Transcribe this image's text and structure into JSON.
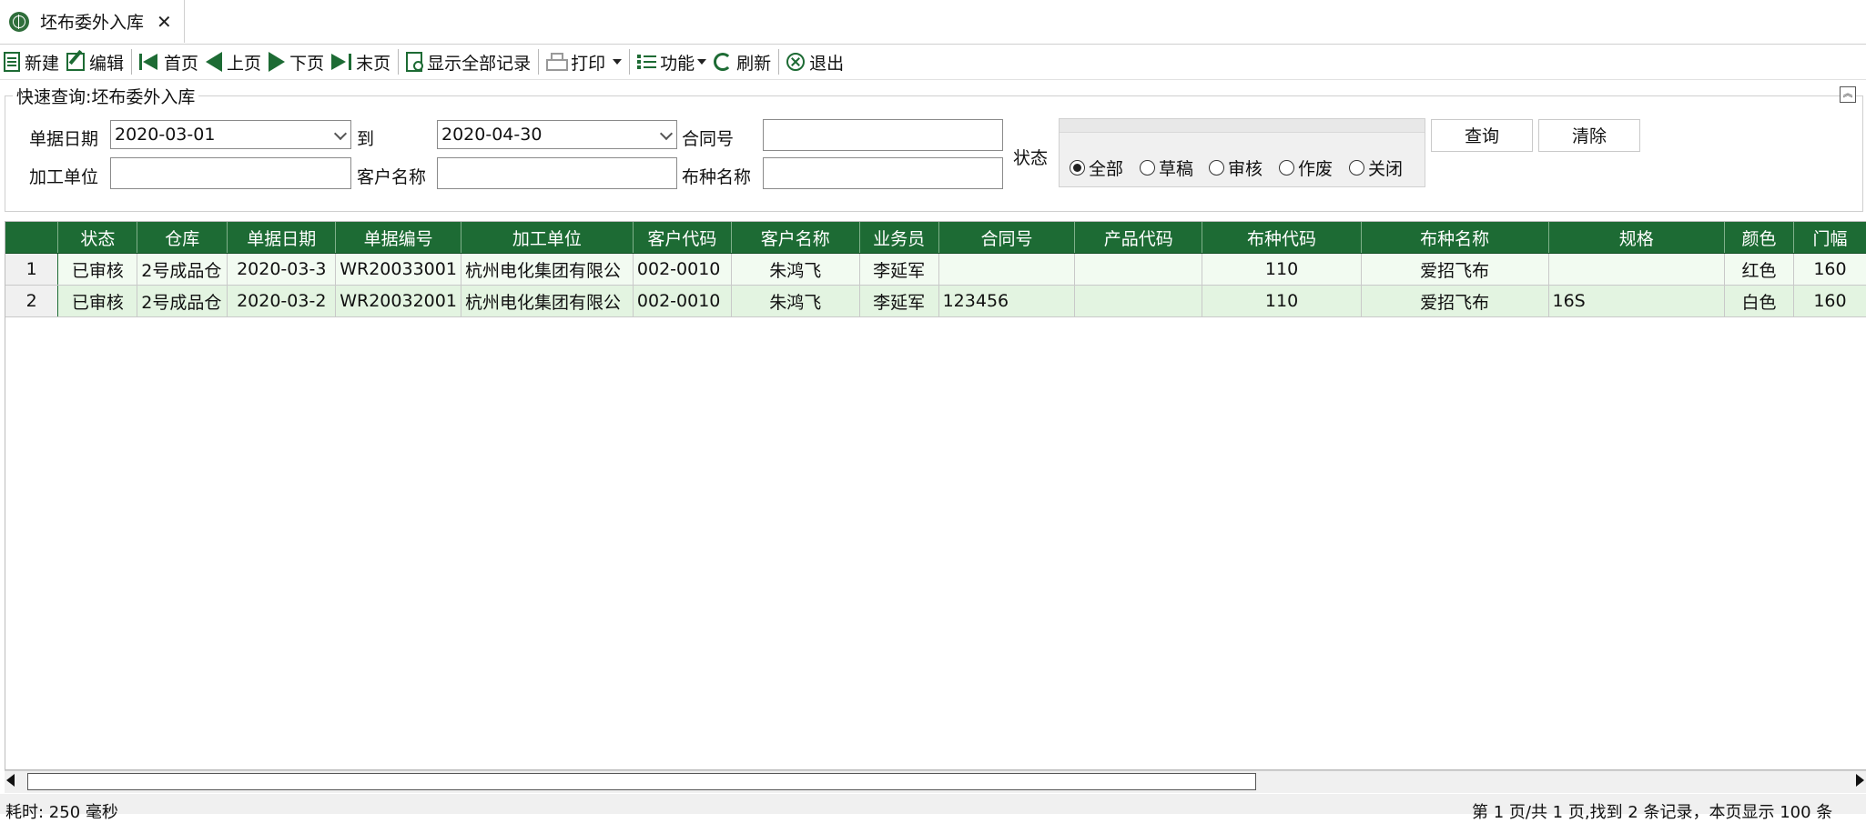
{
  "tab": {
    "title": "坯布委外入库",
    "close": "✕"
  },
  "toolbar": {
    "new": "新建",
    "edit": "编辑",
    "first": "首页",
    "prev": "上页",
    "next": "下页",
    "last": "末页",
    "show_all": "显示全部记录",
    "print": "打印",
    "func": "功能",
    "refresh": "刷新",
    "exit": "退出"
  },
  "query": {
    "title": "快速查询:坯布委外入库",
    "date_label": "单据日期",
    "date_from": "2020-03-01",
    "to_label": "到",
    "date_to": "2020-04-30",
    "contract_label": "合同号",
    "contract_value": "",
    "processor_label": "加工单位",
    "processor_value": "",
    "customer_label": "客户名称",
    "customer_value": "",
    "fabric_label": "布种名称",
    "fabric_value": "",
    "status_label": "状态",
    "status_options": [
      "全部",
      "草稿",
      "审核",
      "作废",
      "关闭"
    ],
    "status_selected": "全部",
    "query_btn": "查询",
    "clear_btn": "清除"
  },
  "grid": {
    "columns": [
      "状态",
      "仓库",
      "单据日期",
      "单据编号",
      "加工单位",
      "客户代码",
      "客户名称",
      "业务员",
      "合同号",
      "产品代码",
      "布种代码",
      "布种名称",
      "规格",
      "颜色",
      "门幅"
    ],
    "rows": [
      {
        "no": "1",
        "cells": [
          "已审核",
          "2号成品仓",
          "2020-03-3",
          "WR20033001",
          "杭州电化集团有限公",
          "002-0010",
          "朱鸿飞",
          "李延军",
          "",
          "",
          "110",
          "爱招飞布",
          "",
          "红色",
          "160"
        ]
      },
      {
        "no": "2",
        "cells": [
          "已审核",
          "2号成品仓",
          "2020-03-2",
          "WR20032001",
          "杭州电化集团有限公",
          "002-0010",
          "朱鸿飞",
          "李延军",
          "123456",
          "",
          "110",
          "爱招飞布",
          "16S",
          "白色",
          "160"
        ]
      }
    ]
  },
  "status": {
    "left": "耗时: 250 毫秒",
    "right": "第 1 页/共 1 页,找到 2 条记录，本页显示 100 条"
  },
  "colors": {
    "header_green": "#1d6b34",
    "row_bg": "#f2fbf1",
    "row_alt": "#e3f4e1"
  }
}
